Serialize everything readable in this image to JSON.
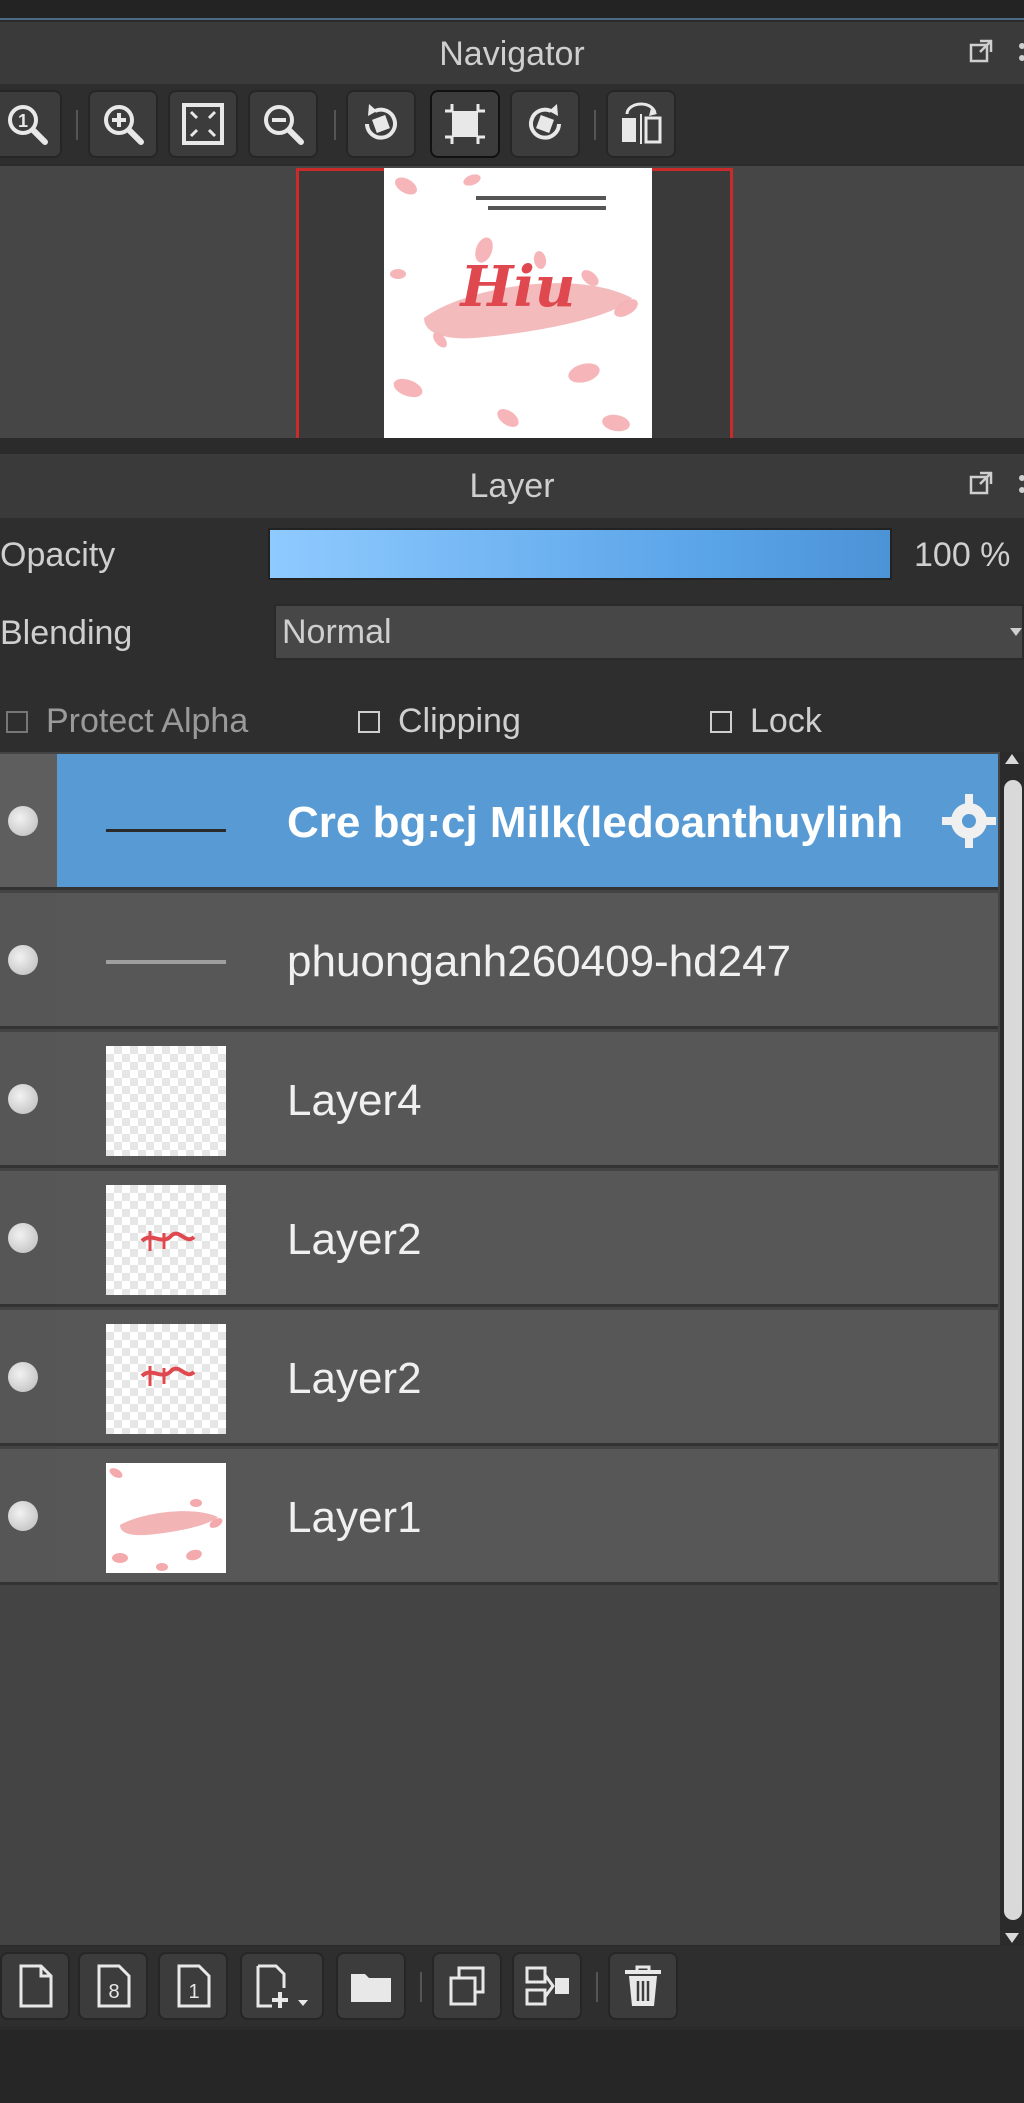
{
  "navigator": {
    "title": "Navigator",
    "tools": [
      {
        "icon": "zoom-actual-icon"
      },
      {
        "icon": "zoom-in-icon"
      },
      {
        "icon": "fit-window-icon"
      },
      {
        "icon": "zoom-out-icon"
      },
      {
        "icon": "rotate-left-icon"
      },
      {
        "icon": "reset-view-icon"
      },
      {
        "icon": "rotate-right-icon"
      },
      {
        "icon": "flip-horizontal-icon"
      }
    ],
    "preview_text": "Hiu"
  },
  "layer_panel": {
    "title": "Layer",
    "opacity_label": "Opacity",
    "opacity_value": "100 %",
    "opacity_fraction": 1.0,
    "blending_label": "Blending",
    "blending_value": "Normal",
    "protect_alpha_label": "Protect Alpha",
    "clipping_label": "Clipping",
    "lock_label": "Lock",
    "accent_color": "#589bd4",
    "layers": [
      {
        "name": "Cre bg:cj Milk(ledoanthuylinh",
        "selected": true,
        "thumb": "text-line"
      },
      {
        "name": "phuonganh260409-hd247",
        "selected": false,
        "thumb": "text-line"
      },
      {
        "name": "Layer4",
        "selected": false,
        "thumb": "empty"
      },
      {
        "name": "Layer2",
        "selected": false,
        "thumb": "red-script"
      },
      {
        "name": "Layer2",
        "selected": false,
        "thumb": "red-script"
      },
      {
        "name": "Layer1",
        "selected": false,
        "thumb": "petals"
      }
    ]
  },
  "bottom_toolbar": [
    {
      "icon": "new-layer-icon"
    },
    {
      "icon": "new-8bit-layer-icon"
    },
    {
      "icon": "new-1bit-layer-icon"
    },
    {
      "icon": "add-layer-menu-icon"
    },
    {
      "icon": "new-folder-icon"
    },
    {
      "icon": "duplicate-layer-icon"
    },
    {
      "icon": "merge-down-icon"
    },
    {
      "icon": "delete-layer-icon"
    }
  ]
}
